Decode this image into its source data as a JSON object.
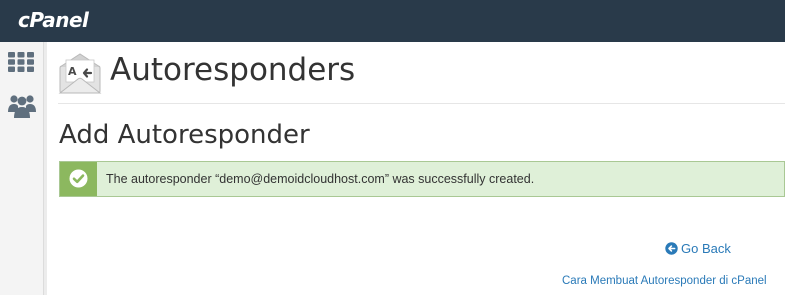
{
  "topbar": {
    "logo_text": "cPanel",
    "background_color": "#293a4a"
  },
  "sidebar": {
    "items": [
      {
        "icon": "grid-icon",
        "name": "apps"
      },
      {
        "icon": "users-icon",
        "name": "users"
      }
    ]
  },
  "header": {
    "icon": "autoresponder-envelope-icon",
    "title": "Autoresponders"
  },
  "section": {
    "title": "Add Autoresponder"
  },
  "alert": {
    "type": "success",
    "icon": "check-circle-icon",
    "message": "The autoresponder “demo@demoidcloudhost.com” was successfully created.",
    "background_color": "#dff0d8",
    "accent_color": "#8cb85f"
  },
  "links": {
    "go_back": "Go Back",
    "go_back_icon": "arrow-left-circle-icon",
    "help": "Cara Membuat Autoresponder di cPanel",
    "link_color": "#2a7ab8"
  }
}
